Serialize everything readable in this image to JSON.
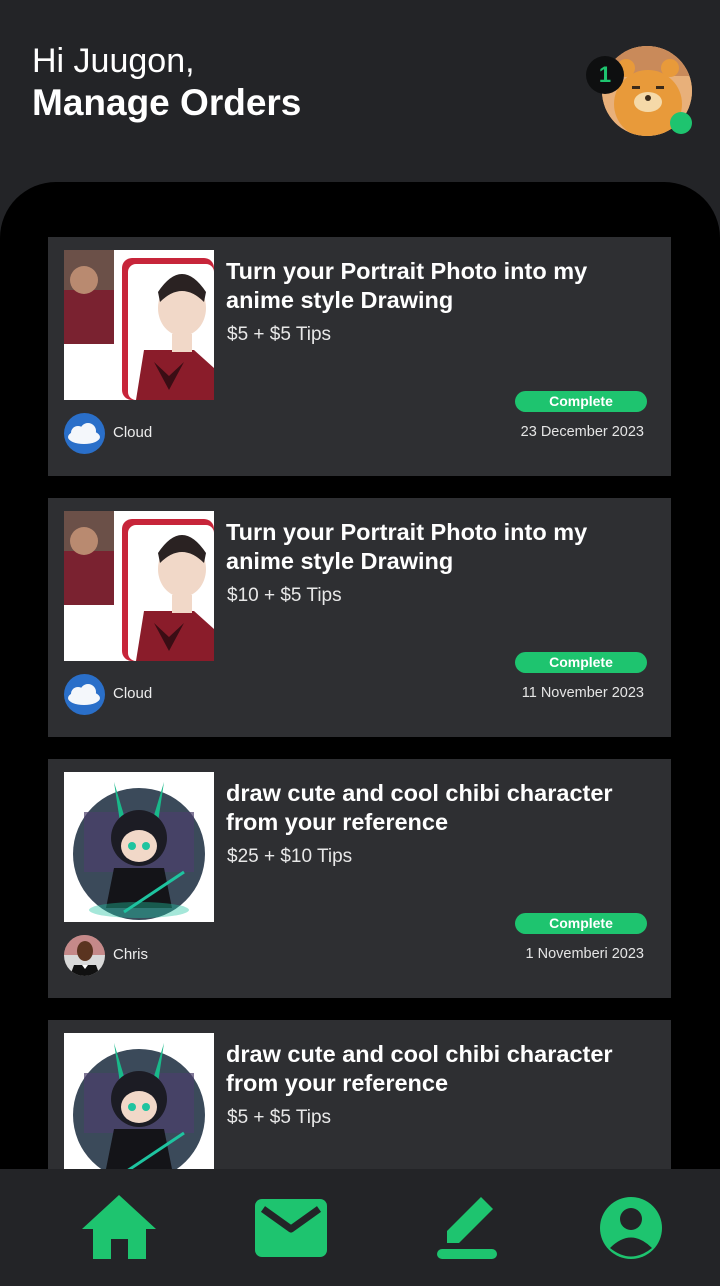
{
  "header": {
    "greeting": "Hi Juugon,",
    "title": "Manage Orders",
    "notification_count": "1"
  },
  "orders": [
    {
      "title": "Turn your Portrait Photo into my anime style Drawing",
      "price": "$5 + $5 Tips",
      "status": "Complete",
      "buyer": "Cloud",
      "date": "23 December 2023",
      "thumbnail": "portrait-anime-thumbnail",
      "buyer_avatar": "cloud-avatar"
    },
    {
      "title": "Turn your Portrait Photo into my anime style Drawing",
      "price": "$10 + $5 Tips",
      "status": "Complete",
      "buyer": "Cloud",
      "date": "11 November 2023",
      "thumbnail": "portrait-anime-thumbnail",
      "buyer_avatar": "cloud-avatar"
    },
    {
      "title": "draw cute and cool chibi character from your reference",
      "price": "$25 + $10 Tips",
      "status": "Complete",
      "buyer": "Chris",
      "date": "1 Novemberi 2023",
      "thumbnail": "chibi-character-thumbnail",
      "buyer_avatar": "chris-avatar"
    },
    {
      "title": "draw cute and cool chibi character from your reference",
      "price": "$5 + $5 Tips",
      "thumbnail": "chibi-character-thumbnail"
    }
  ],
  "nav": {
    "items": [
      "home-icon",
      "mail-icon",
      "edit-icon",
      "profile-icon"
    ]
  },
  "colors": {
    "background": "#232427",
    "sheet": "#000000",
    "card": "#2e2f32",
    "accent": "#1ec46f"
  }
}
